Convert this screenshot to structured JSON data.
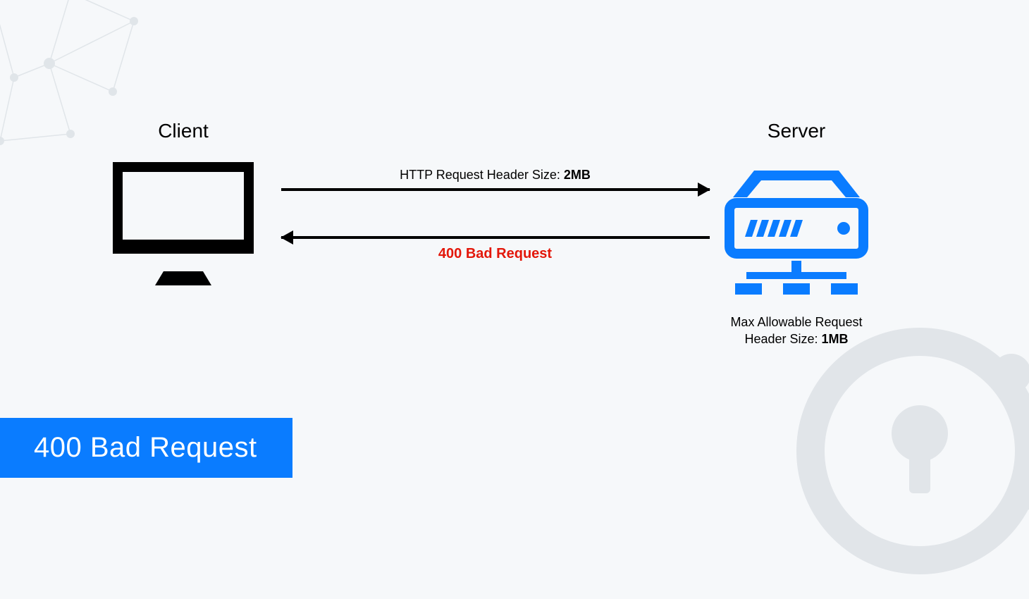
{
  "client": {
    "label": "Client"
  },
  "server": {
    "label": "Server",
    "desc_line1": "Max Allowable Request",
    "desc_line2_prefix": "Header Size: ",
    "desc_line2_value": "1MB"
  },
  "request": {
    "label_prefix": "HTTP Request Header Size: ",
    "label_value": "2MB"
  },
  "response": {
    "label": "400 Bad Request"
  },
  "title": "400 Bad Request",
  "colors": {
    "accent_blue": "#0a7cff",
    "error_red": "#e3170a",
    "bg": "#f6f8fa",
    "deco_gray": "#e1e5e9"
  },
  "icons": {
    "client": "monitor-icon",
    "server": "server-icon"
  }
}
